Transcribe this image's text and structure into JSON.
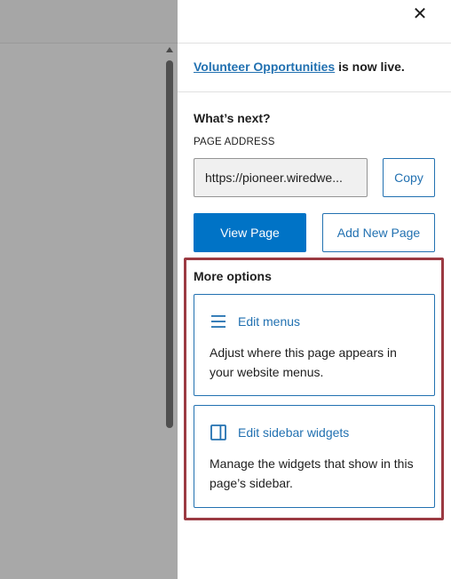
{
  "live_notice": {
    "page_link": "Volunteer Opportunities",
    "suffix": " is now live."
  },
  "next": {
    "heading": "What’s next?",
    "address_label": "PAGE ADDRESS",
    "address_value": "https://pioneer.wiredwe...",
    "copy_label": "Copy",
    "view_page_label": "View Page",
    "add_new_page_label": "Add New Page"
  },
  "more_options": {
    "heading": "More options",
    "cards": [
      {
        "icon": "menu-lines-icon",
        "title": "Edit menus",
        "description": "Adjust where this page appears in your website menus."
      },
      {
        "icon": "sidebar-layout-icon",
        "title": "Edit sidebar widgets",
        "description": "Manage the widgets that show in this page’s sidebar."
      }
    ]
  },
  "colors": {
    "accent": "#2271b1",
    "primary_button": "#0073c6",
    "highlight_border": "#9b3a42",
    "overlay": "#a8a8a8"
  }
}
